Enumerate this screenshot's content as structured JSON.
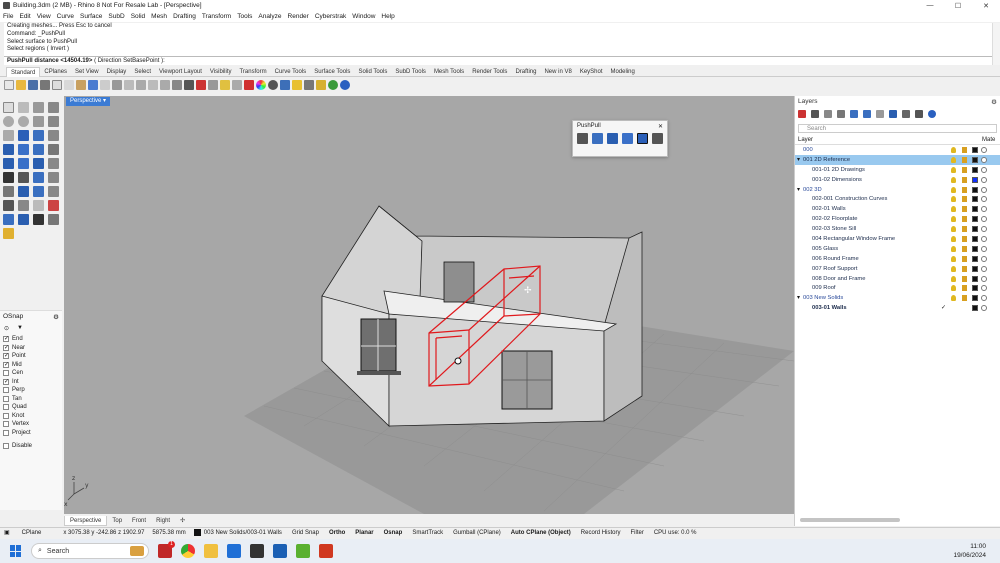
{
  "window": {
    "title": "Building.3dm (2 MB) - Rhino 8 Not For Resale Lab - [Perspective]",
    "min": "—",
    "max": "☐",
    "close": "✕"
  },
  "menu": [
    "File",
    "Edit",
    "View",
    "Curve",
    "Surface",
    "SubD",
    "Solid",
    "Mesh",
    "Drafting",
    "Transform",
    "Tools",
    "Analyze",
    "Render",
    "Cyberstrak",
    "Window",
    "Help"
  ],
  "command_history": [
    "Creating meshes... Press Esc to cancel",
    "Command: _PushPull",
    "Select surface to PushPull",
    "Select regions ( Invert )"
  ],
  "command_prompt": {
    "label": "PushPull distance <14504.19>",
    "options": "( Direction  SetBasePoint ):"
  },
  "toolbar_tabs": [
    "Standard",
    "CPlanes",
    "Set View",
    "Display",
    "Select",
    "Viewport Layout",
    "Visibility",
    "Transform",
    "Curve Tools",
    "Surface Tools",
    "Solid Tools",
    "SubD Tools",
    "Mesh Tools",
    "Render Tools",
    "Drafting",
    "New in V8",
    "KeyShot",
    "Modeling"
  ],
  "viewport": {
    "title": "Perspective",
    "dropdown": "▾",
    "tabs": [
      "Perspective",
      "Top",
      "Front",
      "Right"
    ],
    "add_tab": "✢",
    "axis_labels": [
      "z",
      "y",
      "x"
    ]
  },
  "pushpull_panel": {
    "title": "PushPull",
    "icons": [
      "pushpull-icon",
      "extrude-face-icon",
      "extrude-solid-icon",
      "offset-face-icon",
      "move-face-icon",
      "cap-icon"
    ]
  },
  "osnap": {
    "title": "OSnap",
    "items": [
      {
        "label": "End",
        "checked": true
      },
      {
        "label": "Near",
        "checked": true
      },
      {
        "label": "Point",
        "checked": true
      },
      {
        "label": "Mid",
        "checked": true
      },
      {
        "label": "Cen",
        "checked": false
      },
      {
        "label": "Int",
        "checked": true
      },
      {
        "label": "Perp",
        "checked": false
      },
      {
        "label": "Tan",
        "checked": false
      },
      {
        "label": "Quad",
        "checked": false
      },
      {
        "label": "Knot",
        "checked": false
      },
      {
        "label": "Vertex",
        "checked": false
      },
      {
        "label": "Project",
        "checked": false
      }
    ],
    "disable": "Disable"
  },
  "layers": {
    "title": "Layers",
    "search_placeholder": "Search",
    "col_layer": "Layer",
    "col_material": "Mate",
    "rows": [
      {
        "name": "000",
        "indent": 0,
        "expander": "",
        "color": "#111111",
        "selected": false,
        "current": false
      },
      {
        "name": "001 2D Reference",
        "indent": 0,
        "expander": "▾",
        "color": "#111111",
        "selected": true,
        "current": false
      },
      {
        "name": "001-01 2D Drawings",
        "indent": 1,
        "expander": "",
        "color": "#111111",
        "selected": false,
        "current": false
      },
      {
        "name": "001-02 Dimensions",
        "indent": 1,
        "expander": "",
        "color": "#1030ff",
        "selected": false,
        "current": false
      },
      {
        "name": "002 3D",
        "indent": 0,
        "expander": "▾",
        "color": "#111111",
        "selected": false,
        "current": false
      },
      {
        "name": "002-001 Construction Curves",
        "indent": 1,
        "expander": "",
        "color": "#111111",
        "selected": false,
        "current": false
      },
      {
        "name": "002-01 Walls",
        "indent": 1,
        "expander": "",
        "color": "#111111",
        "selected": false,
        "current": false
      },
      {
        "name": "002-02 Floorplate",
        "indent": 1,
        "expander": "",
        "color": "#111111",
        "selected": false,
        "current": false
      },
      {
        "name": "002-03 Stone Sill",
        "indent": 1,
        "expander": "",
        "color": "#111111",
        "selected": false,
        "current": false
      },
      {
        "name": "004 Rectangular Window Frame",
        "indent": 1,
        "expander": "",
        "color": "#111111",
        "selected": false,
        "current": false
      },
      {
        "name": "005 Glass",
        "indent": 1,
        "expander": "",
        "color": "#111111",
        "selected": false,
        "current": false
      },
      {
        "name": "006 Round Frame",
        "indent": 1,
        "expander": "",
        "color": "#111111",
        "selected": false,
        "current": false
      },
      {
        "name": "007 Roof Support",
        "indent": 1,
        "expander": "",
        "color": "#111111",
        "selected": false,
        "current": false
      },
      {
        "name": "008 Door and Frame",
        "indent": 1,
        "expander": "",
        "color": "#111111",
        "selected": false,
        "current": false
      },
      {
        "name": "009 Roof",
        "indent": 1,
        "expander": "",
        "color": "#111111",
        "selected": false,
        "current": false
      },
      {
        "name": "003 New Solids",
        "indent": 0,
        "expander": "▾",
        "color": "#111111",
        "selected": false,
        "current": false
      },
      {
        "name": "003-01 Walls",
        "indent": 1,
        "expander": "",
        "color": "#111111",
        "selected": false,
        "current": true
      }
    ],
    "current_mark": "✓"
  },
  "statusbar": {
    "cplane": "CPlane",
    "coords": "x 3075.38   y -242.86   z 1902.97",
    "units": "5875.38 mm",
    "layer": "003 New Solids/003-01 Walls",
    "toggles": [
      {
        "label": "Grid Snap",
        "bold": false
      },
      {
        "label": "Ortho",
        "bold": true
      },
      {
        "label": "Planar",
        "bold": true
      },
      {
        "label": "Osnap",
        "bold": true
      },
      {
        "label": "SmartTrack",
        "bold": false
      },
      {
        "label": "Gumball (CPlane)",
        "bold": false
      },
      {
        "label": "Auto CPlane (Object)",
        "bold": true
      },
      {
        "label": "Record History",
        "bold": false
      },
      {
        "label": "Filter",
        "bold": false
      },
      {
        "label": "CPU use: 0.0 %",
        "bold": false
      }
    ]
  },
  "taskbar": {
    "search": "Search",
    "time": "11:00",
    "date": "19/06/2024",
    "badge": "1"
  },
  "colors": {
    "viewport_bg": "#a7a7a7",
    "selection_red": "#e0191d",
    "accent_blue": "#3b7bd4",
    "layer_selected": "#99c9ef"
  }
}
